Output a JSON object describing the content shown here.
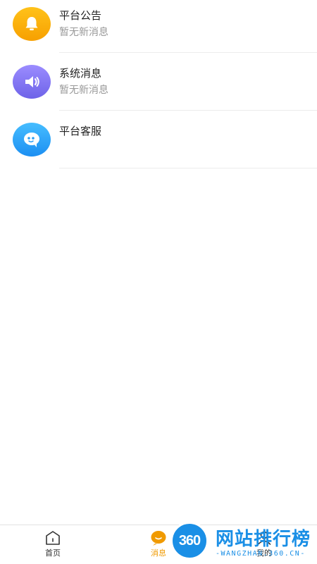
{
  "messages": [
    {
      "title": "平台公告",
      "subtitle": "暂无新消息",
      "icon": "bell-icon",
      "color": "#f7a000"
    },
    {
      "title": "系统消息",
      "subtitle": "暂无新消息",
      "icon": "speaker-icon",
      "color": "#7b6ef0"
    },
    {
      "title": "平台客服",
      "subtitle": "",
      "icon": "chat-bubble-icon",
      "color": "#2b9ff5"
    }
  ],
  "tabbar": {
    "tabs": [
      {
        "label": "首页",
        "icon": "home-icon",
        "active": false
      },
      {
        "label": "消息",
        "icon": "message-icon",
        "active": true
      },
      {
        "label": "我的",
        "icon": "profile-icon",
        "active": false
      }
    ],
    "active_color": "#f09a00"
  },
  "watermark": {
    "number": "360",
    "title": "网站排行榜",
    "url": "-WANGZHAN.360.CN-",
    "color": "#1a8fe6"
  }
}
